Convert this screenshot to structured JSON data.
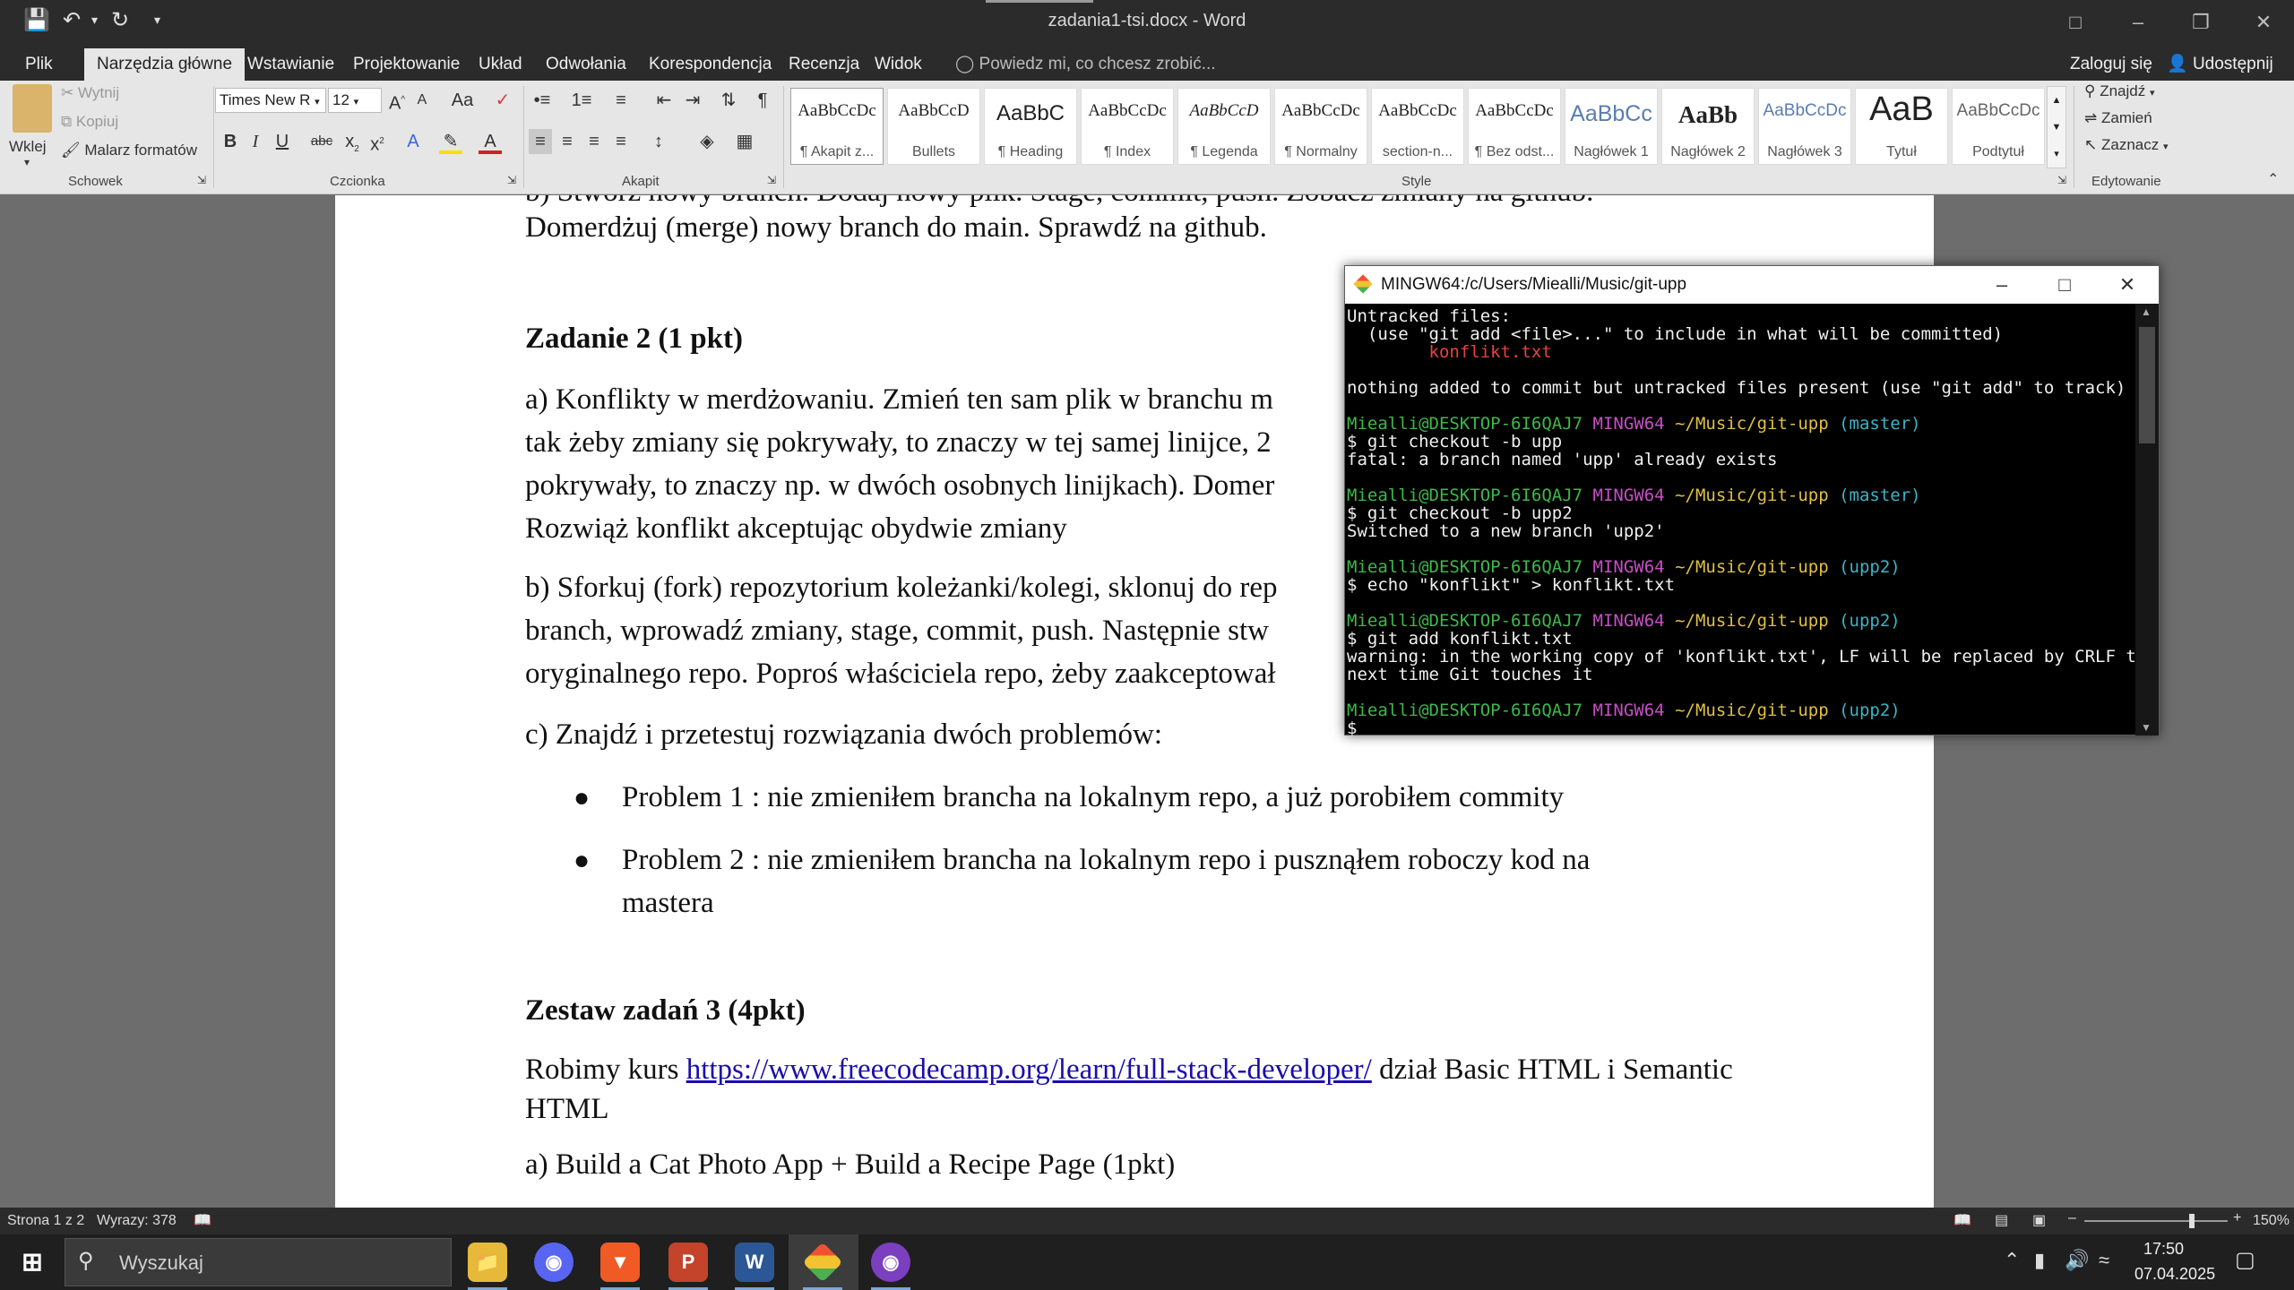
{
  "window": {
    "title": "zadania1-tsi.docx - Word"
  },
  "quick_access": {
    "save_icon": "save-icon",
    "undo_icon": "undo-icon",
    "redo_icon": "redo-icon"
  },
  "tabs": [
    {
      "label": "Plik"
    },
    {
      "label": "Narzędzia główne",
      "active": true
    },
    {
      "label": "Wstawianie"
    },
    {
      "label": "Projektowanie"
    },
    {
      "label": "Układ"
    },
    {
      "label": "Odwołania"
    },
    {
      "label": "Korespondencja"
    },
    {
      "label": "Recenzja"
    },
    {
      "label": "Widok"
    }
  ],
  "tellme": "Powiedz mi, co chcesz zrobić...",
  "signin": "Zaloguj się",
  "share": "Udostępnij",
  "clipboard": {
    "paste": "Wklej",
    "cut": "Wytnij",
    "copy": "Kopiuj",
    "painter": "Malarz formatów",
    "group": "Schowek"
  },
  "font": {
    "name": "Times New R",
    "size": "12",
    "group": "Czcionka"
  },
  "paragraph": {
    "group": "Akapit"
  },
  "styles": {
    "group": "Style",
    "items": [
      {
        "preview": "AaBbCcDc",
        "name": "¶ Akapit z..."
      },
      {
        "preview": "AaBbCcD",
        "name": "Bullets"
      },
      {
        "preview": "AaBbC",
        "name": "¶ Heading"
      },
      {
        "preview": "AaBbCcDc",
        "name": "¶ Index"
      },
      {
        "preview": "AaBbCcD",
        "name": "¶ Legenda"
      },
      {
        "preview": "AaBbCcDc",
        "name": "¶ Normalny"
      },
      {
        "preview": "AaBbCcDc",
        "name": "section-n..."
      },
      {
        "preview": "AaBbCcDc",
        "name": "¶ Bez odst..."
      },
      {
        "preview": "AaBbCc",
        "name": "Nagłówek 1"
      },
      {
        "preview": "AaBb",
        "name": "Nagłówek 2"
      },
      {
        "preview": "AaBbCcDc",
        "name": "Nagłówek 3"
      },
      {
        "preview": "AaB",
        "name": "Tytuł"
      },
      {
        "preview": "AaBbCcDc",
        "name": "Podtytuł"
      }
    ]
  },
  "editing": {
    "find": "Znajdź",
    "replace": "Zamień",
    "select": "Zaznacz",
    "group": "Edytowanie"
  },
  "document": {
    "line_top_partial": "b) Stwórz nowy branch. Dodaj nowy plik. Stage, commit, push. Zobacz zmiany na github.",
    "line_top": "Domerdżuj (merge) nowy branch do main. Sprawdź na github.",
    "heading2": "Zadanie 2 (1 pkt)",
    "a_line1": "a) Konflikty w merdżowaniu. Zmień ten sam plik w branchu m",
    "a_line2": "tak żeby zmiany się pokrywały, to znaczy w tej samej linijce, 2",
    "a_line3": "pokrywały, to znaczy np. w dwóch osobnych linijkach). Domer",
    "a_line4": "Rozwiąż konflikt akceptując obydwie zmiany",
    "b_line1": "b) Sforkuj (fork) repozytorium koleżanki/kolegi, sklonuj do rep",
    "b_line2": "branch, wprowadź zmiany, stage, commit, push. Następnie stw",
    "b_line3": "oryginalnego repo. Poproś właściciela repo, żeby zaakceptował",
    "c_line": "c) Znajdź i przetestuj rozwiązania dwóch problemów:",
    "bullet1": "Problem 1 : nie zmieniłem brancha na lokalnym repo, a już porobiłem commity",
    "bullet2_line1": "Problem 2 : nie zmieniłem brancha na lokalnym repo i pusznąłem roboczy kod na",
    "bullet2_line2": "mastera",
    "heading3": "Zestaw zadań 3 (4pkt)",
    "course_pre": "Robimy kurs ",
    "course_link": "https://www.freecodecamp.org/learn/full-stack-developer/",
    "course_post": " dział Basic HTML i Semantic",
    "course_line2": "HTML",
    "task_a": "a) Build a Cat Photo App + Build a Recipe Page (1pkt)"
  },
  "terminal": {
    "title": "MINGW64:/c/Users/Miealli/Music/git-upp",
    "lines": [
      [
        {
          "t": "Untracked files:",
          "c": ""
        }
      ],
      [
        {
          "t": "  (use \"git add <file>...\" to include in what will be committed)",
          "c": ""
        }
      ],
      [
        {
          "t": "        konflikt.txt",
          "c": "r"
        }
      ],
      [
        {
          "t": "",
          "c": ""
        }
      ],
      [
        {
          "t": "nothing added to commit but untracked files present (use \"git add\" to track)",
          "c": ""
        }
      ],
      [
        {
          "t": "",
          "c": ""
        }
      ],
      [
        {
          "t": "Miealli@DESKTOP-6I6QAJ7",
          "c": "g"
        },
        {
          "t": " MINGW64",
          "c": "m"
        },
        {
          "t": " ~/Music/git-upp",
          "c": "g2"
        },
        {
          "t": " (master)",
          "c": "c"
        }
      ],
      [
        {
          "t": "$ git checkout -b upp",
          "c": ""
        }
      ],
      [
        {
          "t": "fatal: a branch named 'upp' already exists",
          "c": ""
        }
      ],
      [
        {
          "t": "",
          "c": ""
        }
      ],
      [
        {
          "t": "Miealli@DESKTOP-6I6QAJ7",
          "c": "g"
        },
        {
          "t": " MINGW64",
          "c": "m"
        },
        {
          "t": " ~/Music/git-upp",
          "c": "g2"
        },
        {
          "t": " (master)",
          "c": "c"
        }
      ],
      [
        {
          "t": "$ git checkout -b upp2",
          "c": ""
        }
      ],
      [
        {
          "t": "Switched to a new branch 'upp2'",
          "c": ""
        }
      ],
      [
        {
          "t": "",
          "c": ""
        }
      ],
      [
        {
          "t": "Miealli@DESKTOP-6I6QAJ7",
          "c": "g"
        },
        {
          "t": " MINGW64",
          "c": "m"
        },
        {
          "t": " ~/Music/git-upp",
          "c": "g2"
        },
        {
          "t": " (upp2)",
          "c": "c"
        }
      ],
      [
        {
          "t": "$ echo \"konflikt\" > konflikt.txt",
          "c": ""
        }
      ],
      [
        {
          "t": "",
          "c": ""
        }
      ],
      [
        {
          "t": "Miealli@DESKTOP-6I6QAJ7",
          "c": "g"
        },
        {
          "t": " MINGW64",
          "c": "m"
        },
        {
          "t": " ~/Music/git-upp",
          "c": "g2"
        },
        {
          "t": " (upp2)",
          "c": "c"
        }
      ],
      [
        {
          "t": "$ git add konflikt.txt",
          "c": ""
        }
      ],
      [
        {
          "t": "warning: in the working copy of 'konflikt.txt', LF will be replaced by CRLF the",
          "c": ""
        }
      ],
      [
        {
          "t": "next time Git touches it",
          "c": ""
        }
      ],
      [
        {
          "t": "",
          "c": ""
        }
      ],
      [
        {
          "t": "Miealli@DESKTOP-6I6QAJ7",
          "c": "g"
        },
        {
          "t": " MINGW64",
          "c": "m"
        },
        {
          "t": " ~/Music/git-upp",
          "c": "g2"
        },
        {
          "t": " (upp2)",
          "c": "c"
        }
      ],
      [
        {
          "t": "$",
          "c": ""
        }
      ]
    ]
  },
  "status": {
    "page": "Strona 1 z 2",
    "words": "Wyrazy: 378",
    "zoom": "150%",
    "zoom_level": 0.75
  },
  "taskbar": {
    "search_placeholder": "Wyszukaj",
    "time": "17:50",
    "date": "07.04.2025"
  },
  "colors": {
    "term_green": "#3cb84a",
    "term_magenta": "#c64fc4",
    "term_cyan": "#3ab4c6",
    "term_red": "#e84141",
    "link": "#1a0dab"
  }
}
